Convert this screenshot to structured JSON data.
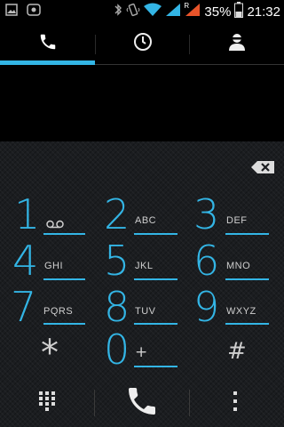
{
  "status_bar": {
    "battery_percent": "35%",
    "time": "21:32",
    "roaming_badge": "R",
    "icons": [
      "gallery-icon",
      "notification-icon",
      "bluetooth-icon",
      "vibrate-icon",
      "wifi-icon",
      "signal-icon",
      "signal-roaming-icon",
      "battery-icon"
    ]
  },
  "tabs": [
    {
      "id": "phone",
      "icon": "phone-icon",
      "selected": true
    },
    {
      "id": "call-log",
      "icon": "clock-icon",
      "selected": false
    },
    {
      "id": "contacts",
      "icon": "person-icon",
      "selected": false
    }
  ],
  "dialer": {
    "number": "",
    "keys": [
      {
        "digit": "1",
        "letters": "",
        "sub_icon": "voicemail-icon"
      },
      {
        "digit": "2",
        "letters": "ABC"
      },
      {
        "digit": "3",
        "letters": "DEF"
      },
      {
        "digit": "4",
        "letters": "GHI"
      },
      {
        "digit": "5",
        "letters": "JKL"
      },
      {
        "digit": "6",
        "letters": "MNO"
      },
      {
        "digit": "7",
        "letters": "PQRS"
      },
      {
        "digit": "8",
        "letters": "TUV"
      },
      {
        "digit": "9",
        "letters": "WXYZ"
      },
      {
        "digit": "*",
        "letters": ""
      },
      {
        "digit": "0",
        "letters": "+"
      },
      {
        "digit": "#",
        "letters": ""
      }
    ]
  },
  "bottom_bar": {
    "icons": [
      "dialpad-icon",
      "call-icon",
      "overflow-menu-icon"
    ]
  },
  "colors": {
    "accent": "#33b5e5",
    "background": "#000000",
    "keypad_bg": "#1b1d20",
    "text_secondary": "#cfcfcf"
  }
}
